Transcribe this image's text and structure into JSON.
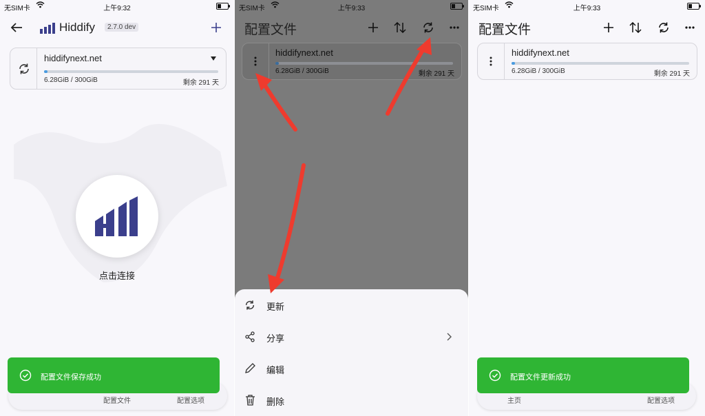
{
  "status_bar": {
    "carrier": "无SIM卡",
    "time_1": "上午9:32",
    "time_2": "上午9:33",
    "time_3": "上午9:33"
  },
  "home": {
    "app_name": "Hiddify",
    "version": "2.7.0 dev",
    "profile_name": "hiddifynext.net",
    "usage": "6.28GiB / 300GiB",
    "remaining": "剩余 291 天",
    "usage_fraction": 0.021,
    "connect_label": "点击连接",
    "toast": "配置文件保存成功",
    "nav": [
      "配置文件",
      "配置选项"
    ]
  },
  "profiles_menu": {
    "title": "配置文件",
    "profile_name": "hiddifynext.net",
    "usage": "6.28GiB / 300GiB",
    "remaining": "剩余 291 天",
    "menu": [
      {
        "label": "更新",
        "icon": "refresh-icon"
      },
      {
        "label": "分享",
        "icon": "share-icon"
      },
      {
        "label": "编辑",
        "icon": "pencil-icon"
      },
      {
        "label": "删除",
        "icon": "trash-icon"
      }
    ]
  },
  "profiles_updated": {
    "title": "配置文件",
    "profile_name": "hiddifynext.net",
    "usage": "6.28GiB / 300GiB",
    "remaining": "剩余 291 天",
    "toast": "配置文件更新成功",
    "nav": [
      "主页",
      "配置选项"
    ]
  },
  "colors": {
    "toast_green": "#2fb534",
    "brand_navy": "#3b3f8c",
    "progress_blue": "#4a9be0",
    "arrow_red": "#ee3b2e"
  }
}
